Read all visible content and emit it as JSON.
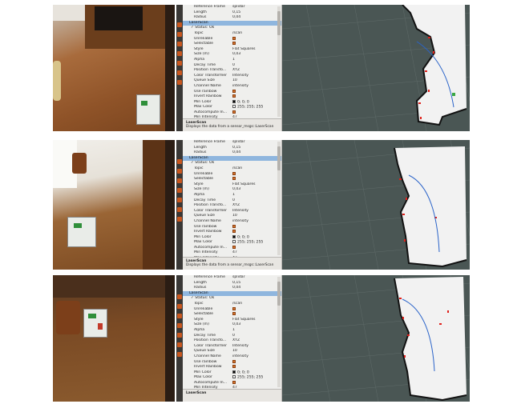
{
  "panels": [
    {
      "rows": [
        {
          "key": "Reference Frame",
          "value": "splidar"
        },
        {
          "key": "Length",
          "value": "0,15"
        },
        {
          "key": "Radius",
          "value": "0,04"
        },
        {
          "key": "LaserScan",
          "value": "",
          "selected": true
        },
        {
          "key": "✓ Status: Ok",
          "value": "",
          "sub": true
        },
        {
          "key": "Topic",
          "value": "/scan"
        },
        {
          "key": "Unreliable",
          "value": ""
        },
        {
          "key": "Selectable",
          "value": ""
        },
        {
          "key": "Style",
          "value": "Flat Squares"
        },
        {
          "key": "Size (m)",
          "value": "0,03"
        },
        {
          "key": "Alpha",
          "value": "1"
        },
        {
          "key": "Decay Time",
          "value": "0"
        },
        {
          "key": "Position Transfo...",
          "value": "XYZ"
        },
        {
          "key": "Color Transformer",
          "value": "Intensity"
        },
        {
          "key": "Queue Size",
          "value": "10"
        },
        {
          "key": "Channel Name",
          "value": "intensity"
        },
        {
          "key": "Use rainbow",
          "value": ""
        },
        {
          "key": "Invert Rainbow",
          "value": ""
        },
        {
          "key": "Min Color",
          "value": "0; 0; 0"
        },
        {
          "key": "Max Color",
          "value": "255; 255; 255"
        },
        {
          "key": "Autocompute In...",
          "value": ""
        },
        {
          "key": "Min Intensity",
          "value": "47"
        },
        {
          "key": "Max Intensity",
          "value": "47"
        }
      ],
      "footer_title": "LaserScan",
      "footer_desc": "Displays the data from a sensor_msgs::LaserScan"
    },
    {
      "rows": [
        {
          "key": "Reference Frame",
          "value": "splidar"
        },
        {
          "key": "Length",
          "value": "0,15"
        },
        {
          "key": "Radius",
          "value": "0,04"
        },
        {
          "key": "LaserScan",
          "value": "",
          "selected": true
        },
        {
          "key": "✓ Status: Ok",
          "value": "",
          "sub": true
        },
        {
          "key": "Topic",
          "value": "/scan"
        },
        {
          "key": "Unreliable",
          "value": ""
        },
        {
          "key": "Selectable",
          "value": ""
        },
        {
          "key": "Style",
          "value": "Flat Squares"
        },
        {
          "key": "Size (m)",
          "value": "0,03"
        },
        {
          "key": "Alpha",
          "value": "1"
        },
        {
          "key": "Decay Time",
          "value": "0"
        },
        {
          "key": "Position Transfo...",
          "value": "XYZ"
        },
        {
          "key": "Color Transformer",
          "value": "Intensity"
        },
        {
          "key": "Queue Size",
          "value": "10"
        },
        {
          "key": "Channel Name",
          "value": "intensity"
        },
        {
          "key": "Use rainbow",
          "value": ""
        },
        {
          "key": "Invert Rainbow",
          "value": ""
        },
        {
          "key": "Min Color",
          "value": "0; 0; 0"
        },
        {
          "key": "Max Color",
          "value": "255; 255; 255"
        },
        {
          "key": "Autocompute In...",
          "value": ""
        },
        {
          "key": "Min Intensity",
          "value": "47"
        },
        {
          "key": "Max Intensity",
          "value": "47"
        }
      ],
      "footer_title": "LaserScan",
      "footer_desc": "Displays the data from a sensor_msgs::LaserScan"
    },
    {
      "rows": [
        {
          "key": "Reference Frame",
          "value": "splidar"
        },
        {
          "key": "Length",
          "value": "0,15"
        },
        {
          "key": "Radius",
          "value": "0,04"
        },
        {
          "key": "LaserScan",
          "value": "",
          "selected": true
        },
        {
          "key": "✓ Status: Ok",
          "value": "",
          "sub": true
        },
        {
          "key": "Topic",
          "value": "/scan"
        },
        {
          "key": "Unreliable",
          "value": ""
        },
        {
          "key": "Selectable",
          "value": ""
        },
        {
          "key": "Style",
          "value": "Flat Squares"
        },
        {
          "key": "Size (m)",
          "value": "0,03"
        },
        {
          "key": "Alpha",
          "value": "1"
        },
        {
          "key": "Decay Time",
          "value": "0"
        },
        {
          "key": "Position Transfo...",
          "value": "XYZ"
        },
        {
          "key": "Color Transformer",
          "value": "Intensity"
        },
        {
          "key": "Queue Size",
          "value": "10"
        },
        {
          "key": "Channel Name",
          "value": "intensity"
        },
        {
          "key": "Use rainbow",
          "value": ""
        },
        {
          "key": "Invert Rainbow",
          "value": ""
        },
        {
          "key": "Min Color",
          "value": "0; 0; 0"
        },
        {
          "key": "Max Color",
          "value": "255; 255; 255"
        },
        {
          "key": "Autocompute In...",
          "value": ""
        },
        {
          "key": "Min Intensity",
          "value": "47"
        },
        {
          "key": "Max Intensity",
          "value": "47"
        }
      ],
      "footer_title": "LaserScan",
      "footer_desc": ""
    }
  ],
  "colors": {
    "map_background": "#4a5654",
    "free_space": "#f2f2f2",
    "laser_points": "#e0201a",
    "trajectory": "#2a63c9",
    "panel_selection": "#8fb6de"
  }
}
